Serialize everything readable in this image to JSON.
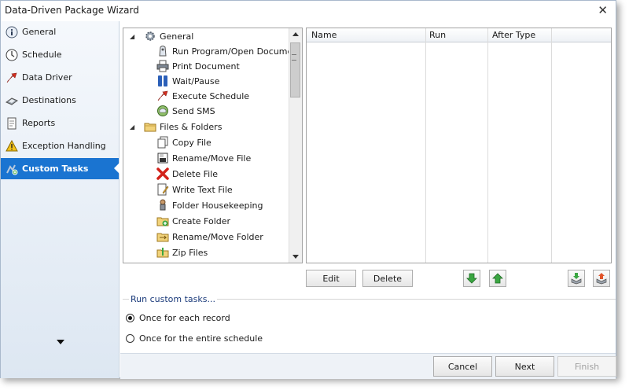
{
  "window": {
    "title": "Data-Driven Package Wizard",
    "close_glyph": "✕"
  },
  "sidebar": {
    "items": [
      {
        "label": "General",
        "icon": "info-icon"
      },
      {
        "label": "Schedule",
        "icon": "clock-icon"
      },
      {
        "label": "Data Driver",
        "icon": "data-driver-icon"
      },
      {
        "label": "Destinations",
        "icon": "destinations-icon"
      },
      {
        "label": "Reports",
        "icon": "report-icon"
      },
      {
        "label": "Exception Handling",
        "icon": "warning-icon"
      },
      {
        "label": "Custom Tasks",
        "icon": "custom-tasks-icon",
        "active": true
      }
    ]
  },
  "task_tree": {
    "groups": [
      {
        "label": "General",
        "items": [
          "Run Program/Open Document",
          "Print Document",
          "Wait/Pause",
          "Execute Schedule",
          "Send SMS"
        ]
      },
      {
        "label": "Files & Folders",
        "items": [
          "Copy File",
          "Rename/Move File",
          "Delete File",
          "Write Text File",
          "Folder Housekeeping",
          "Create Folder",
          "Rename/Move Folder",
          "Zip Files"
        ]
      }
    ],
    "expander_glyph": "◢"
  },
  "tasks_grid": {
    "columns": [
      "Name",
      "Run",
      "After Type"
    ]
  },
  "grid_buttons": {
    "edit": "Edit",
    "delete": "Delete"
  },
  "run_options": {
    "title": "Run custom tasks...",
    "options": [
      {
        "label": "Once for each record",
        "checked": true
      },
      {
        "label": "Once for the entire schedule",
        "checked": false
      }
    ]
  },
  "footer": {
    "cancel": "Cancel",
    "next": "Next",
    "finish": "Finish"
  },
  "colors": {
    "accent": "#1a74d1",
    "sidebar_top": "#f5f8fc",
    "sidebar_bottom": "#dde7f2"
  }
}
